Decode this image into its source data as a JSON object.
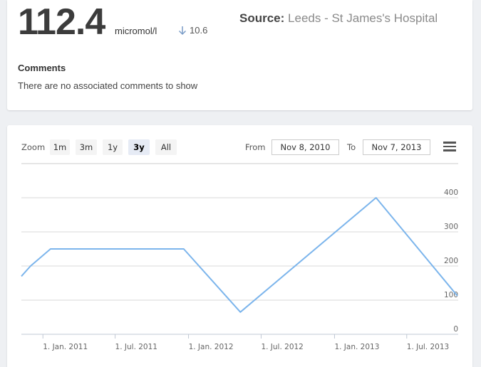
{
  "summary": {
    "value": "112.4",
    "unit": "micromol/l",
    "delta": "10.6",
    "delta_direction": "down",
    "source_label": "Source:",
    "source_value": "Leeds - St James's Hospital",
    "comments_heading": "Comments",
    "comments_text": "There are no associated comments to show"
  },
  "toolbar": {
    "zoom_label": "Zoom",
    "zoom_buttons": [
      "1m",
      "3m",
      "1y",
      "3y",
      "All"
    ],
    "active_zoom": "3y",
    "from_label": "From",
    "from_value": "Nov 8, 2010",
    "to_label": "To",
    "to_value": "Nov 7, 2013",
    "menu_icon": "hamburger-menu-icon"
  },
  "colors": {
    "line": "#7cb5ec",
    "grid": "#d8d8d8",
    "active_button": "#e6ebf5"
  },
  "chart_data": {
    "type": "line",
    "x_tick_labels": [
      "1. Jan. 2011",
      "1. Jul. 2011",
      "1. Jan. 2012",
      "1. Jul. 2012",
      "1. Jan. 2013",
      "1. Jul. 2013"
    ],
    "y_tick_labels": [
      "0",
      "100",
      "200",
      "300",
      "400"
    ],
    "ylim": [
      0,
      400
    ],
    "xlim": [
      "2010-11-08",
      "2013-11-07"
    ],
    "grid": true,
    "series": [
      {
        "points": [
          {
            "x": "2010-11-08",
            "y": 170
          },
          {
            "x": "2010-12-01",
            "y": 200
          },
          {
            "x": "2011-01-20",
            "y": 250
          },
          {
            "x": "2011-12-20",
            "y": 250
          },
          {
            "x": "2012-05-10",
            "y": 65
          },
          {
            "x": "2013-04-15",
            "y": 400
          },
          {
            "x": "2013-11-05",
            "y": 112.4
          }
        ]
      }
    ]
  }
}
